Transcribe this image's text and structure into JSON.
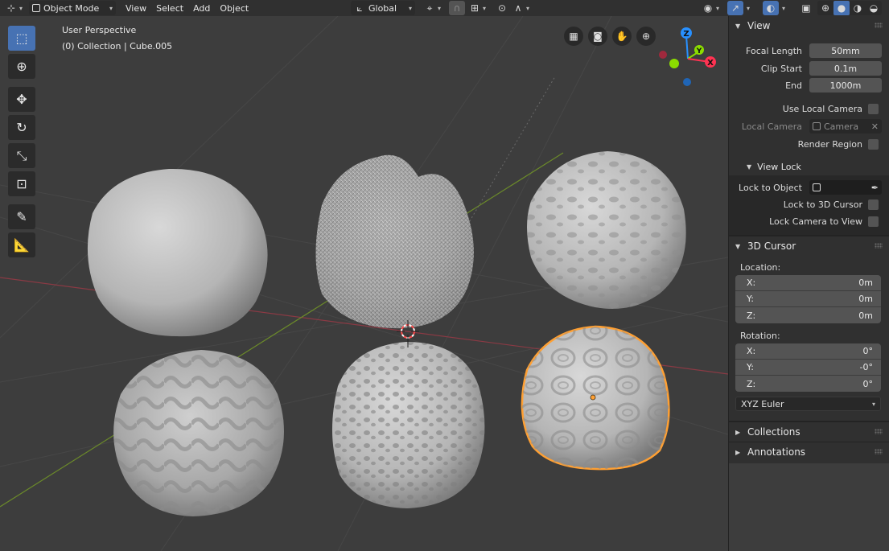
{
  "header": {
    "mode_label": "Object Mode",
    "menus": [
      "View",
      "Select",
      "Add",
      "Object"
    ],
    "orientation_label": "Global",
    "icons": [
      "editor-type-icon",
      "object-mode-icon",
      "orientation-icon",
      "pivot-icon",
      "snap-icon",
      "proportional-editing-icon",
      "visibility-icon",
      "gizmo-icon",
      "overlay-icon",
      "xray-icon",
      "shading-wireframe-icon",
      "shading-solid-icon",
      "shading-material-icon",
      "shading-rendered-icon"
    ]
  },
  "viewport": {
    "view_name": "User Perspective",
    "collection_info": "(0) Collection | Cube.005",
    "gizmo_axes": {
      "z": "Z",
      "y": "Y",
      "x": "X"
    },
    "colors": {
      "x_axis": "#ff3352",
      "y_axis": "#8bdc00",
      "z_axis": "#2890ff",
      "selection": "#ffa033"
    }
  },
  "toolbar": {
    "tools": [
      "select-box-icon",
      "cursor-icon",
      "move-icon",
      "rotate-icon",
      "scale-icon",
      "transform-icon",
      "annotate-icon",
      "measure-icon"
    ]
  },
  "sidebar": {
    "view_panel": {
      "title": "View",
      "focal_length_label": "Focal Length",
      "focal_length_value": "50mm",
      "clip_start_label": "Clip Start",
      "clip_start_value": "0.1m",
      "end_label": "End",
      "end_value": "1000m",
      "use_local_camera_label": "Use Local Camera",
      "local_camera_label": "Local Camera",
      "local_camera_placeholder": "Camera",
      "render_region_label": "Render Region"
    },
    "view_lock_panel": {
      "title": "View Lock",
      "lock_to_object_label": "Lock to Object",
      "lock_to_3d_cursor_label": "Lock to 3D Cursor",
      "lock_camera_to_view_label": "Lock Camera to View"
    },
    "cursor_panel": {
      "title": "3D Cursor",
      "location_label": "Location:",
      "location": [
        {
          "axis": "X:",
          "value": "0m"
        },
        {
          "axis": "Y:",
          "value": "0m"
        },
        {
          "axis": "Z:",
          "value": "0m"
        }
      ],
      "rotation_label": "Rotation:",
      "rotation": [
        {
          "axis": "X:",
          "value": "0°"
        },
        {
          "axis": "Y:",
          "value": "-0°"
        },
        {
          "axis": "Z:",
          "value": "0°"
        }
      ],
      "rotation_mode": "XYZ Euler"
    },
    "collapsed_panels": [
      {
        "title": "Collections"
      },
      {
        "title": "Annotations"
      }
    ]
  }
}
